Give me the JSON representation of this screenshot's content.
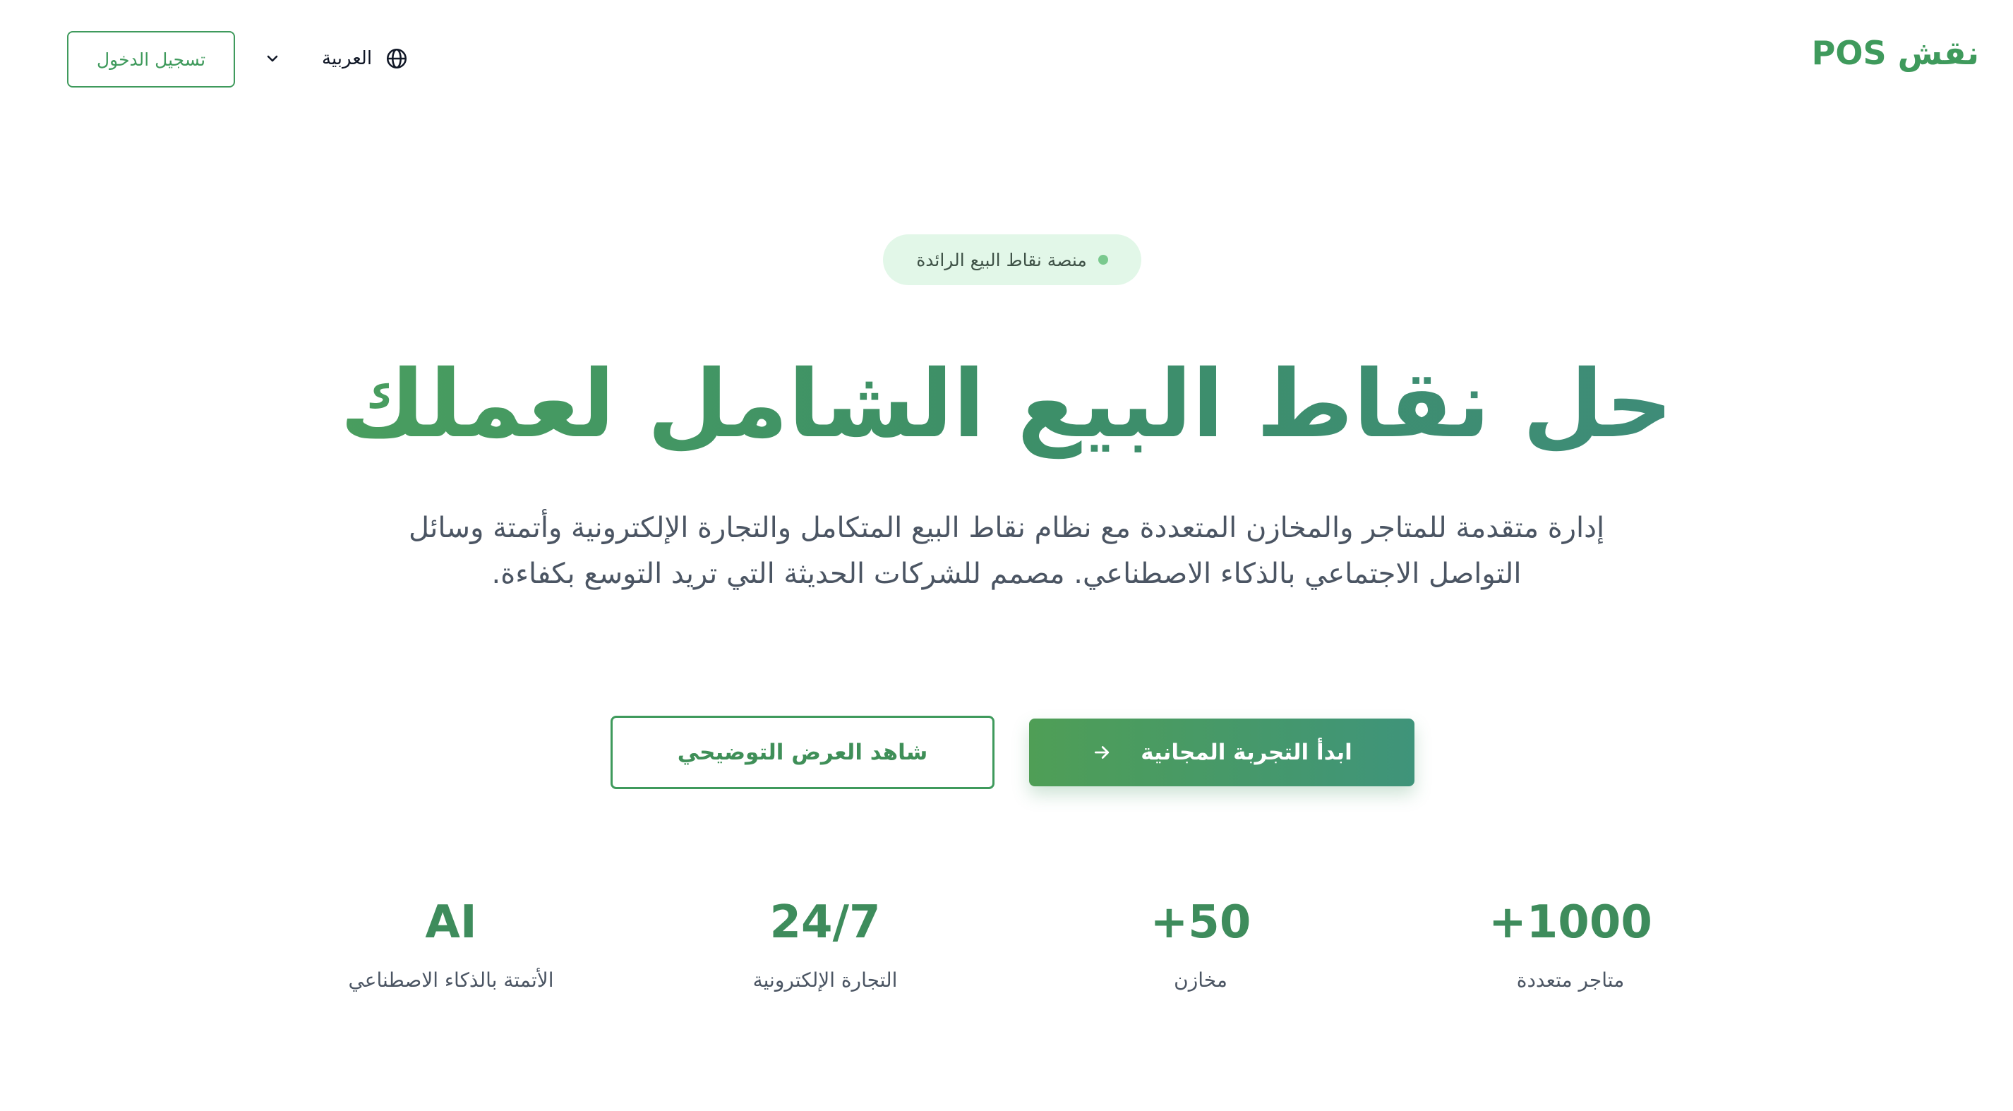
{
  "header": {
    "logo": "نقش POS",
    "language_label": "العربية",
    "login_label": "تسجيل الدخول"
  },
  "hero": {
    "badge": "منصة نقاط البيع الرائدة",
    "title": "حل نقاط البيع الشامل لعملك",
    "subtitle": "إدارة متقدمة للمتاجر والمخازن المتعددة مع نظام نقاط البيع المتكامل والتجارة الإلكترونية وأتمتة وسائل التواصل الاجتماعي بالذكاء الاصطناعي. مصمم للشركات الحديثة التي تريد التوسع بكفاءة.",
    "primary_cta": "ابدأ التجربة المجانية",
    "secondary_cta": "شاهد العرض التوضيحي"
  },
  "stats": [
    {
      "value": "+1000",
      "label": "متاجر متعددة"
    },
    {
      "value": "+50",
      "label": "مخازن"
    },
    {
      "value": "24/7",
      "label": "التجارة الإلكترونية"
    },
    {
      "value": "AI",
      "label": "الأتمتة بالذكاء الاصطناعي"
    }
  ],
  "colors": {
    "brand": "#3f9a5c",
    "badge_bg": "#e2f7e8",
    "text_muted": "#4b5563"
  },
  "icons": {
    "language": "globe-icon",
    "language_dropdown": "chevron-down-icon",
    "cta_arrow": "arrow-right-icon",
    "badge_dot": "dot-icon"
  }
}
